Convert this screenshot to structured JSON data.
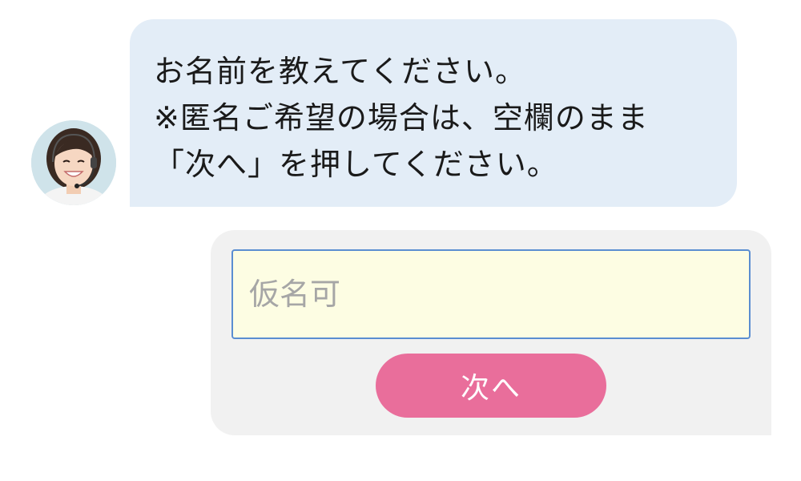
{
  "chat": {
    "message_lines": [
      "お名前を教えてください。",
      "※匿名ご希望の場合は、空欄のまま",
      "「次へ」を押してください。"
    ]
  },
  "avatar": {
    "icon": "operator-avatar"
  },
  "form": {
    "name_input": {
      "value": "",
      "placeholder": "仮名可"
    },
    "next_button_label": "次へ"
  },
  "colors": {
    "bubble": "#e3edf7",
    "panel": "#f1f1f1",
    "input_bg": "#fdfde3",
    "input_border": "#5b8ed1",
    "button": "#e96e9b"
  }
}
